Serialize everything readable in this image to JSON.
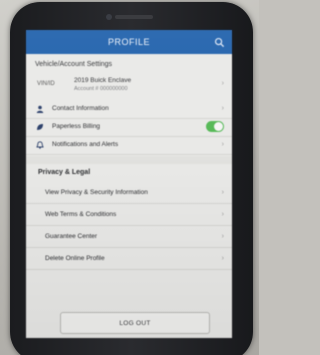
{
  "header": {
    "title": "PROFILE",
    "search_icon": "search-icon",
    "bar_color": "#1d5fab"
  },
  "account_settings": {
    "heading": "Vehicle/Account Settings",
    "label": "VIN/ID",
    "vehicle": "2019 Buick Enclave",
    "sub": "Account # 000000000"
  },
  "settings_rows": [
    {
      "label": "Contact Information",
      "icon": "user-icon"
    },
    {
      "label": "Paperless Billing",
      "icon": "leaf-icon",
      "toggle_on": true
    },
    {
      "label": "Notifications and Alerts",
      "icon": "bell-icon"
    }
  ],
  "privacy": {
    "heading": "Privacy & Legal",
    "rows": [
      {
        "label": "View Privacy & Security Information"
      },
      {
        "label": "Web Terms & Conditions"
      },
      {
        "label": "Guarantee Center"
      },
      {
        "label": "Delete Online Profile"
      }
    ]
  },
  "logout": {
    "label": "LOG OUT"
  },
  "colors": {
    "toggle_on": "#55b956"
  }
}
